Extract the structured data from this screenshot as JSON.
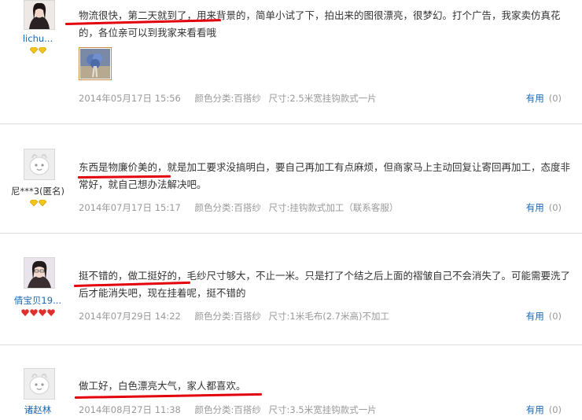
{
  "reviews": [
    {
      "username": "lichu...",
      "comment": "物流很快，第二天就到了，用来背景的，简单小试了下，拍出来的图很漂亮，很梦幻。打个广告，我家卖仿真花的，各位亲可以到我家来看看哦",
      "date": "2014年05月17日 15:56",
      "color_category": "颜色分类:百搭纱",
      "size": "尺寸:2.5米宽挂钩款式一片",
      "useful_label": "有用",
      "useful_count": "(0)",
      "avatar_icon": "profile-photo-girl",
      "badge_icon": "yellow-diamond",
      "badge_count": 2,
      "has_photo": true
    },
    {
      "username": "尼***3(匿名)",
      "comment": "东西是物廉价美的，就是加工要求没搞明白，要自己再加工有点麻烦，但商家马上主动回复让寄回再加工，态度非常好，就自己想办法解决吧。",
      "date": "2014年07月17日 15:17",
      "color_category": "颜色分类:百搭纱",
      "size": "尺寸:挂钩款式加工（联系客服）",
      "useful_label": "有用",
      "useful_count": "(0)",
      "avatar_icon": "default-avatar",
      "badge_icon": "yellow-diamond",
      "badge_count": 2,
      "has_photo": false
    },
    {
      "username": "倩宝贝19...",
      "comment": "挺不错的，做工挺好的，毛纱尺寸够大，不止一米。只是打了个结之后上面的褶皱自己不会消失了。可能需要洗了后才能消失吧，现在挂着呢，挺不错的",
      "date": "2014年07月29日 14:22",
      "color_category": "颜色分类:百搭纱",
      "size": "尺寸:1米毛布(2.7米高)不加工",
      "useful_label": "有用",
      "useful_count": "(0)",
      "avatar_icon": "profile-photo-girl-glasses",
      "badge_icon": "red-heart",
      "badge_count": 4,
      "has_photo": false
    },
    {
      "username": "诸赵林",
      "comment": "做工好，白色漂亮大气，家人都喜欢。",
      "date": "2014年08月27日 11:38",
      "color_category": "颜色分类:百搭纱",
      "size": "尺寸:3.5米宽挂钩款式一片",
      "useful_label": "有用",
      "useful_count": "(0)",
      "avatar_icon": "default-avatar",
      "badge_icon": "",
      "badge_count": 0,
      "has_photo": false
    }
  ],
  "colors": {
    "link_blue": "#1a66b3",
    "annotation_red": "#e3000b",
    "meta_gray": "#999999",
    "separator": "#dcdcdc"
  }
}
